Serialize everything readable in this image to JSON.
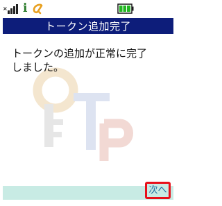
{
  "status_bar": {
    "signal_icon": "signal-strength-icon",
    "info_icon_char": "i",
    "info_icon": "i-mode-icon",
    "app_icon": "alpha-app-icon",
    "battery_icon": "battery-full-icon",
    "colors": {
      "info": "#2d7d2d",
      "app": "#e8a020",
      "battery": "#22b522"
    }
  },
  "title_bar": {
    "title": "トークン追加完了",
    "background": "#0d1d7a"
  },
  "content": {
    "message": "トークンの追加が正常に完了\nしました。",
    "watermark_letters": [
      "O",
      "T",
      "P"
    ]
  },
  "softkey_bar": {
    "next_label": "次へ",
    "background": "#c8ebe4",
    "highlight": "#e8101a"
  }
}
